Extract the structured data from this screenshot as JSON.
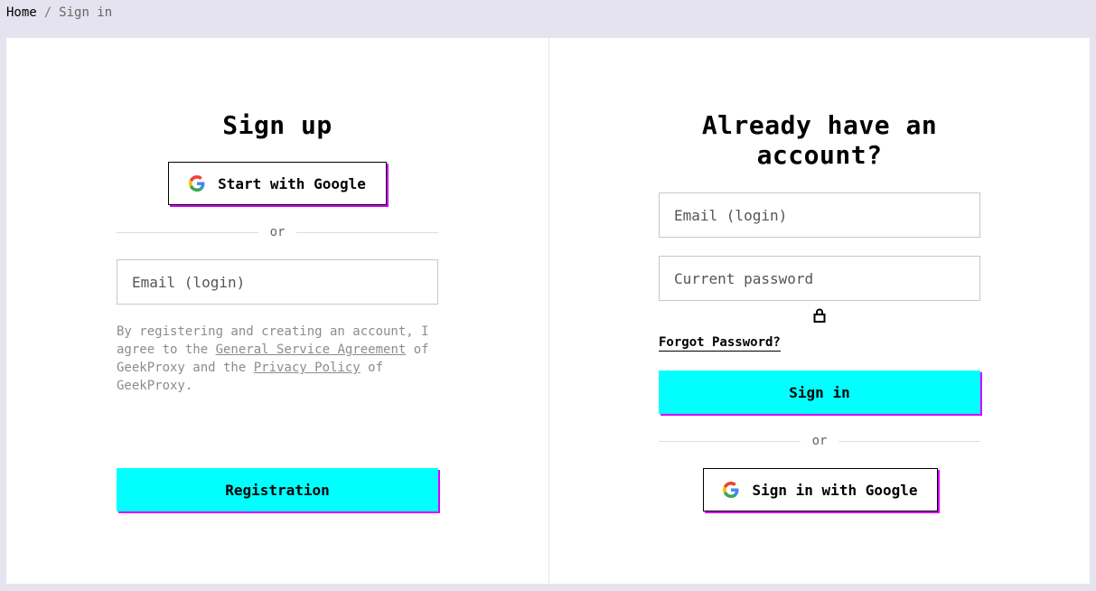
{
  "breadcrumb": {
    "home": "Home",
    "separator": "/",
    "current": "Sign in"
  },
  "signup": {
    "title": "Sign up",
    "google_label": "Start with Google",
    "divider": "or",
    "email_placeholder": "Email (login)",
    "terms": {
      "prefix": "By registering and creating an account, I agree to the ",
      "agreement_link": "General Service Agreement",
      "middle": " of GeekProxy and the ",
      "privacy_link": "Privacy Policy",
      "suffix": " of GeekProxy."
    },
    "register_label": "Registration"
  },
  "signin": {
    "title": "Already have an account?",
    "email_placeholder": "Email (login)",
    "password_placeholder": "Current password",
    "forgot_label": "Forgot Password?",
    "signin_label": "Sign in",
    "divider": "or",
    "google_label": "Sign in with Google"
  },
  "icons": {
    "google": "google-icon",
    "lock": "lock-icon"
  },
  "colors": {
    "accent": "#00ffff",
    "shadow": "#d400ff",
    "background": "#e4e3ef"
  }
}
